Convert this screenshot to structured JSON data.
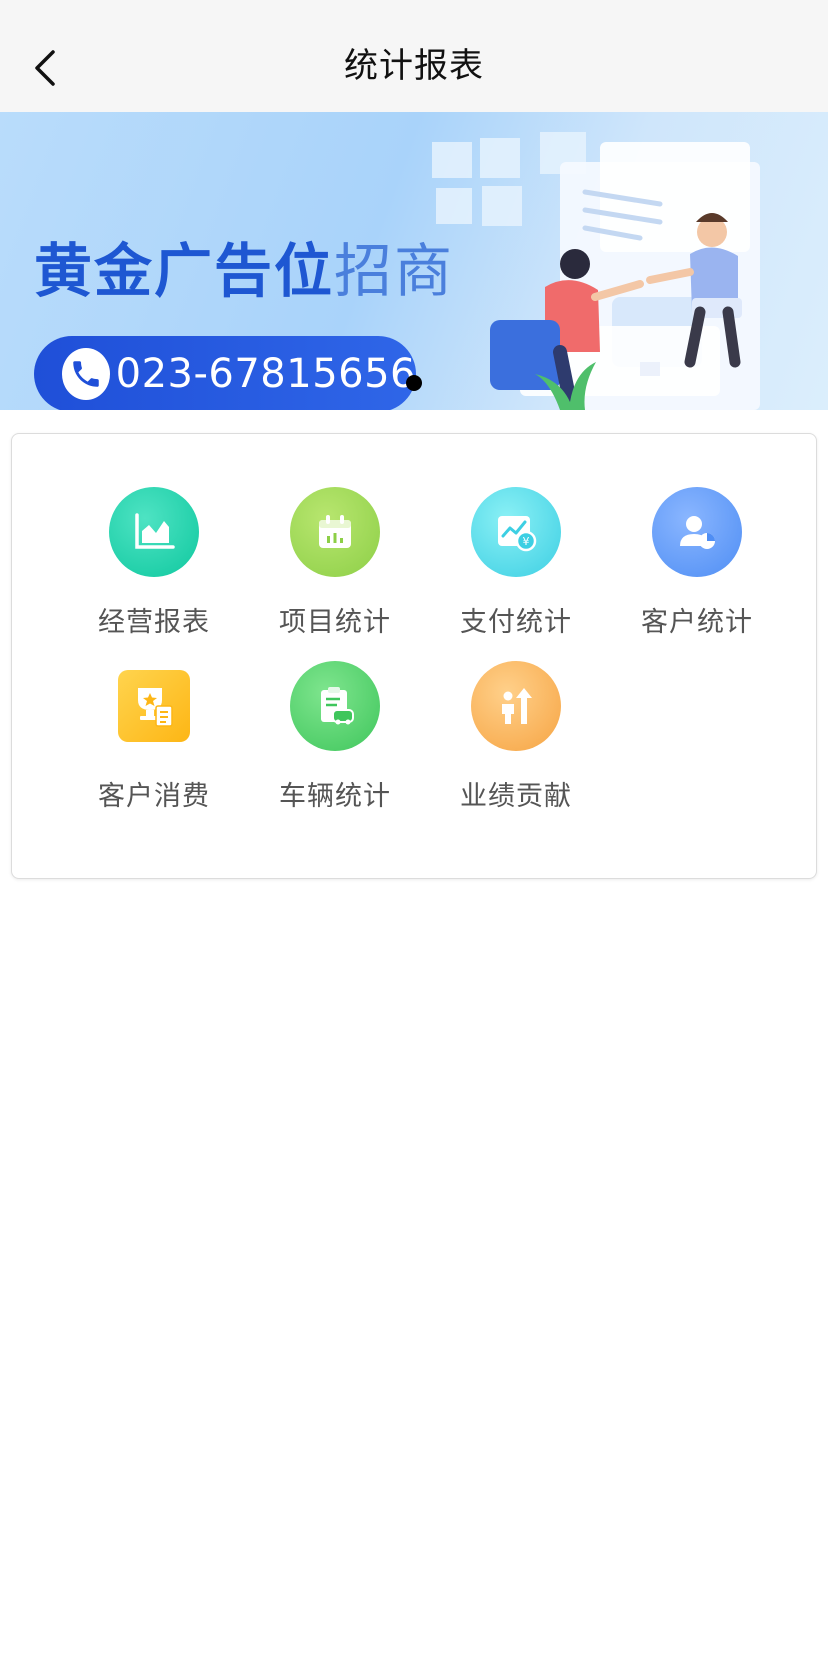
{
  "header": {
    "title": "统计报表",
    "back_icon": "chevron-left-icon"
  },
  "banner": {
    "headline_bold": "黄金广告位",
    "headline_light": "招商",
    "phone_number": "023-67815656",
    "phone_icon": "phone-icon"
  },
  "menu": {
    "items": [
      {
        "label": "经营报表",
        "icon": "area-chart-icon",
        "color": "#12c9a1"
      },
      {
        "label": "项目统计",
        "icon": "calendar-chart-icon",
        "color": "#9bd653"
      },
      {
        "label": "支付统计",
        "icon": "payment-chart-icon",
        "color": "#45d3e5"
      },
      {
        "label": "客户统计",
        "icon": "user-stats-icon",
        "color": "#5a95f5"
      },
      {
        "label": "客户消费",
        "icon": "trophy-icon",
        "color": "#fec22d"
      },
      {
        "label": "车辆统计",
        "icon": "vehicle-clipboard-icon",
        "color": "#47c963"
      },
      {
        "label": "业绩贡献",
        "icon": "performance-icon",
        "color": "#f7aa4c"
      }
    ]
  }
}
